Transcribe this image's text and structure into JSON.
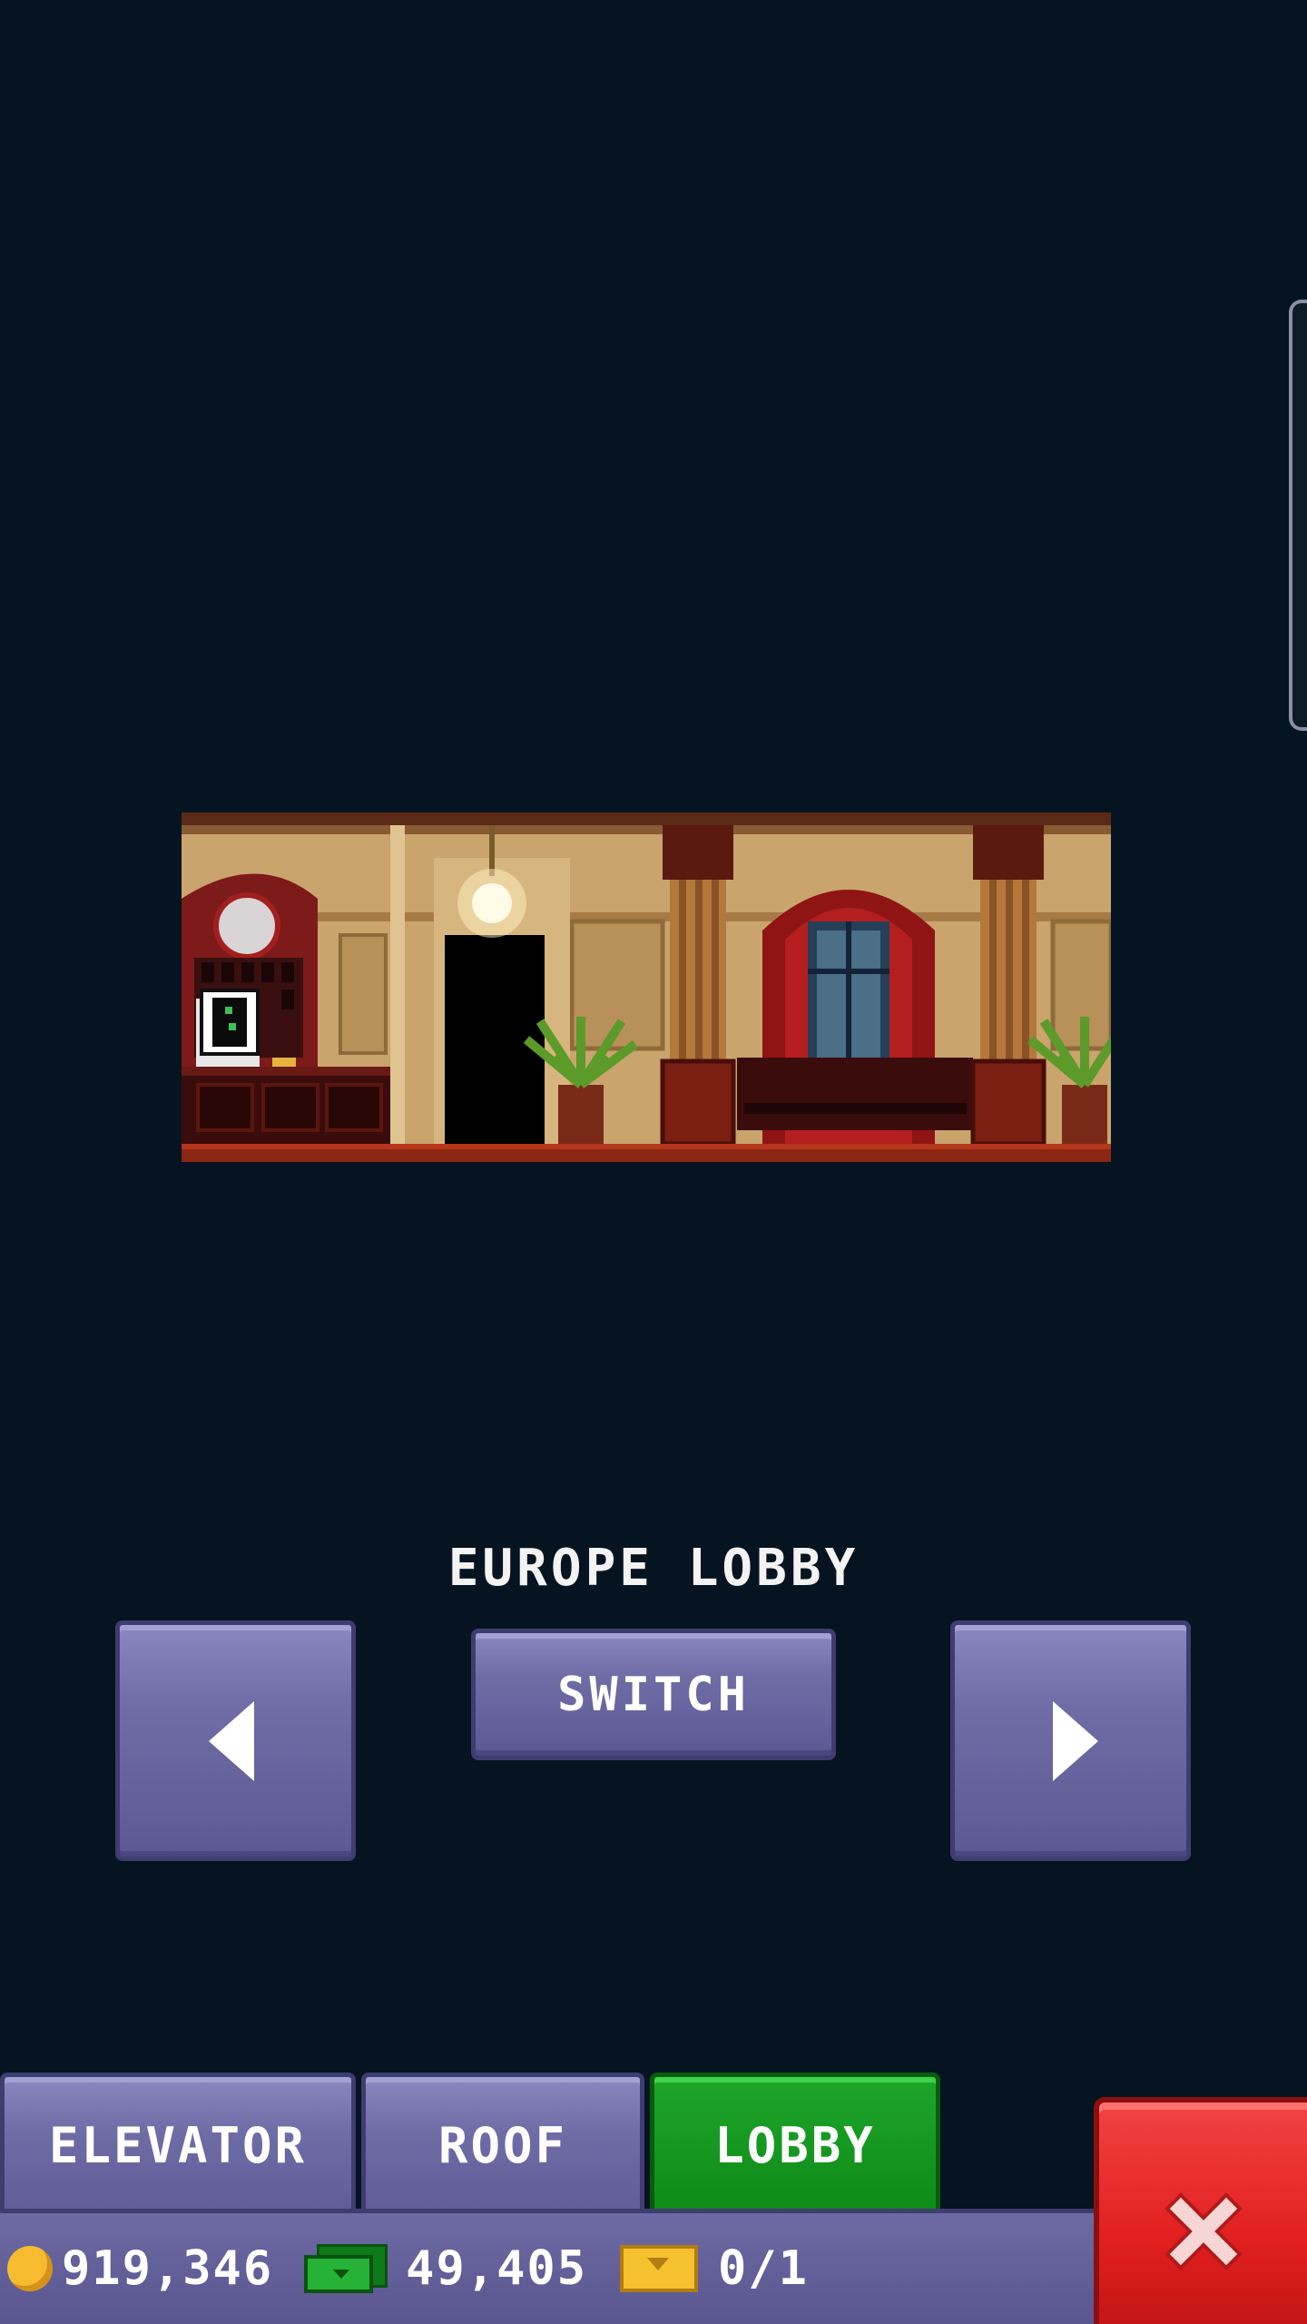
{
  "lobby": {
    "name": "EUROPE LOBBY"
  },
  "controls": {
    "switch_label": "SWITCH",
    "prev_icon": "arrow-left-icon",
    "next_icon": "arrow-right-icon"
  },
  "tabs": [
    {
      "label": "ELEVATOR",
      "active": false
    },
    {
      "label": "ROOF",
      "active": false
    },
    {
      "label": "LOBBY",
      "active": true
    }
  ],
  "currency": {
    "coins": "919,346",
    "bux": "49,405",
    "tickets": "0/1"
  },
  "colors": {
    "background": "#051420",
    "button": "#6f6ca6",
    "active_tab": "#0e8a18",
    "close": "#e32020"
  },
  "icons": {
    "close": "close-icon",
    "coin": "coin-icon",
    "bux": "bux-icon",
    "ticket": "ticket-icon"
  }
}
